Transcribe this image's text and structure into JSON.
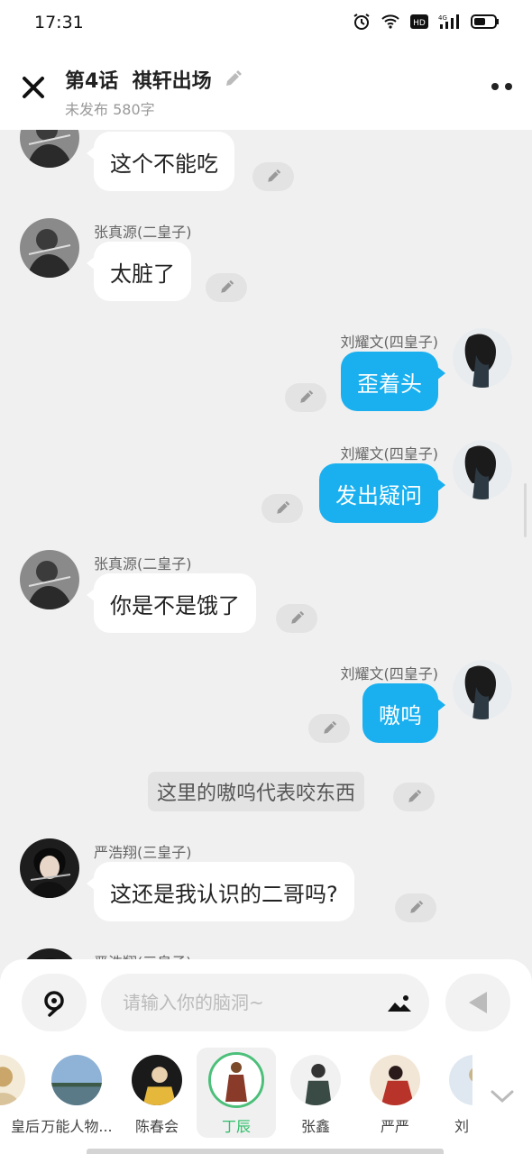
{
  "status_bar": {
    "time": "17:31",
    "icons": [
      "alarm-icon",
      "wifi-icon",
      "hd-icon",
      "signal-4g-icon",
      "battery-icon"
    ]
  },
  "header": {
    "title": "第4话  祺轩出场",
    "subtitle": "未发布 580字"
  },
  "messages": [
    {
      "type": "left",
      "speaker": "",
      "text": "这个不能吃",
      "avatar": "zhang"
    },
    {
      "type": "left",
      "speaker": "张真源(二皇子)",
      "text": "太脏了",
      "avatar": "zhang"
    },
    {
      "type": "right",
      "speaker": "刘耀文(四皇子)",
      "text": "歪着头",
      "avatar": "liu"
    },
    {
      "type": "right",
      "speaker": "刘耀文(四皇子)",
      "text": "发出疑问",
      "avatar": "liu"
    },
    {
      "type": "left",
      "speaker": "张真源(二皇子)",
      "text": "你是不是饿了",
      "avatar": "zhang"
    },
    {
      "type": "right",
      "speaker": "刘耀文(四皇子)",
      "text": "嗷呜",
      "avatar": "liu"
    },
    {
      "type": "narration",
      "text": "这里的嗷呜代表咬东西"
    },
    {
      "type": "left",
      "speaker": "严浩翔(三皇子)",
      "text": "这还是我认识的二哥吗?",
      "avatar": "yan"
    },
    {
      "type": "left",
      "speaker": "严浩翔(三皇子)",
      "text": "",
      "avatar": "yan"
    }
  ],
  "input": {
    "placeholder": "请输入你的脑洞~"
  },
  "roles": [
    {
      "name": "皇后",
      "selected": false
    },
    {
      "name": "万能人物...",
      "selected": false
    },
    {
      "name": "陈春会",
      "selected": false
    },
    {
      "name": "丁辰",
      "selected": true
    },
    {
      "name": "张鑫",
      "selected": false
    },
    {
      "name": "严严",
      "selected": false
    },
    {
      "name": "刘",
      "selected": false
    }
  ],
  "colors": {
    "accent_blue": "#1ab0f0",
    "selected_green": "#4cc07a",
    "bg": "#f0f0f0"
  }
}
